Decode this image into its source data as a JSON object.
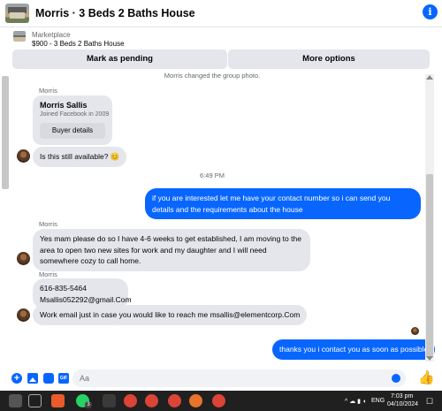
{
  "header": {
    "title": "Morris · 3 Beds 2 Baths House"
  },
  "marketplace": {
    "label": "Marketplace",
    "item": "$900 - 3 Beds 2 Baths House",
    "mark_pending": "Mark as pending",
    "more_options": "More options"
  },
  "chat": {
    "system_line": "Morris changed the group photo.",
    "card": {
      "sender": "Morris",
      "name": "Morris Sallis",
      "joined": "Joined Facebook in 2009",
      "button": "Buyer details"
    },
    "msg_available": "Is this still available? 😊",
    "time": "6:49 PM",
    "out_1": "if you are interested let me have your contact number so i can send you details and the requirements about the house",
    "sender_2": "Morris",
    "in_2": "Yes mam please do so I have 4-6 weeks to get established, I am moving to the area to open two new sites for work and my daughter and I will need somewhere cozy to call home.",
    "sender_3": "Morris",
    "phone": "616-835-5464",
    "email": "Msallis052292@gmail.Com",
    "in_4": "Work email just in case you would like to reach me msallis@elementcorp.Com",
    "out_2": "thanks you i contact you as soon as possible"
  },
  "composer": {
    "placeholder": "Aa"
  },
  "taskbar": {
    "lang": "ENG",
    "time": "7:03 pm",
    "date": "04/10/2024",
    "badge": "3"
  },
  "colors": {
    "accent": "#0866ff",
    "bubble_in": "#e4e6eb",
    "taskbar": "#202020"
  }
}
